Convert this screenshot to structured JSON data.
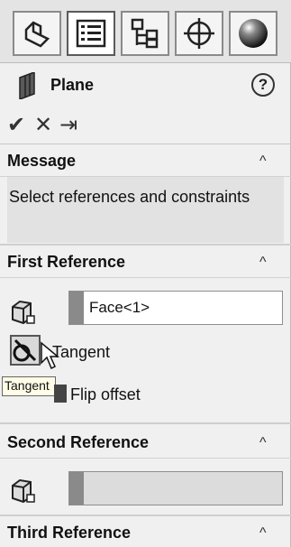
{
  "colors": {
    "panel_bg": "#f0f0f0",
    "message_bg": "#e2e2e2",
    "selection_bar": "#8a8a8a"
  },
  "tabs": [
    {
      "name": "featuremanager-tab",
      "icon": "feature-manager-icon"
    },
    {
      "name": "propertymanager-tab",
      "icon": "property-manager-icon",
      "active": true
    },
    {
      "name": "configurationmanager-tab",
      "icon": "configuration-manager-icon"
    },
    {
      "name": "dimxpertmanager-tab",
      "icon": "crosshair-icon"
    },
    {
      "name": "displaymanager-tab",
      "icon": "appearance-sphere-icon"
    }
  ],
  "header": {
    "title": "Plane",
    "help_label": "?"
  },
  "actions": {
    "ok": "✔",
    "cancel": "✕",
    "pushpin": "⇥"
  },
  "message": {
    "title": "Message",
    "text": "Select references and constraints"
  },
  "first_reference": {
    "title": "First Reference",
    "value": "Face<1>",
    "option_label": "Tangent",
    "flip_label": "Flip offset",
    "tooltip": "Tangent"
  },
  "second_reference": {
    "title": "Second Reference",
    "value": ""
  },
  "third_reference": {
    "title": "Third Reference"
  },
  "chevron": "^"
}
